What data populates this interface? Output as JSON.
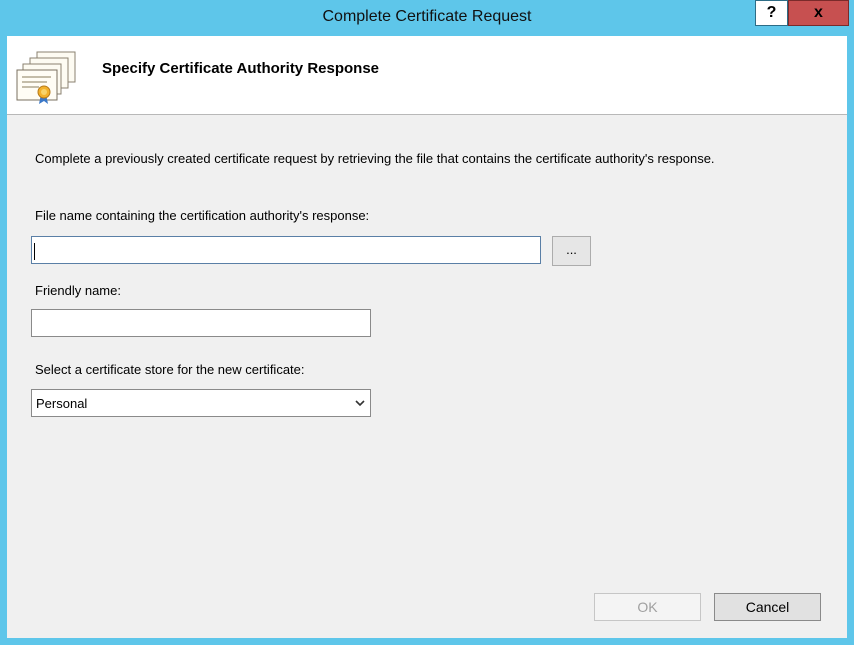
{
  "window": {
    "title": "Complete Certificate Request"
  },
  "titlebar_buttons": {
    "help": "?",
    "close": "x"
  },
  "header": {
    "title": "Specify Certificate Authority Response",
    "icon": "certificate-icon"
  },
  "description": "Complete a previously created certificate request by retrieving the file that contains the certificate authority's response.",
  "file_field": {
    "label": "File name containing the certification authority's response:",
    "value": "",
    "browse_label": "..."
  },
  "friendly_field": {
    "label": "Friendly name:",
    "value": ""
  },
  "store_field": {
    "label": "Select a certificate store for the new certificate:",
    "selected": "Personal"
  },
  "buttons": {
    "ok": "OK",
    "cancel": "Cancel",
    "ok_enabled": false
  },
  "colors": {
    "frame": "#5ec6ea",
    "client": "#f0f0f0",
    "close_button": "#c75050"
  }
}
